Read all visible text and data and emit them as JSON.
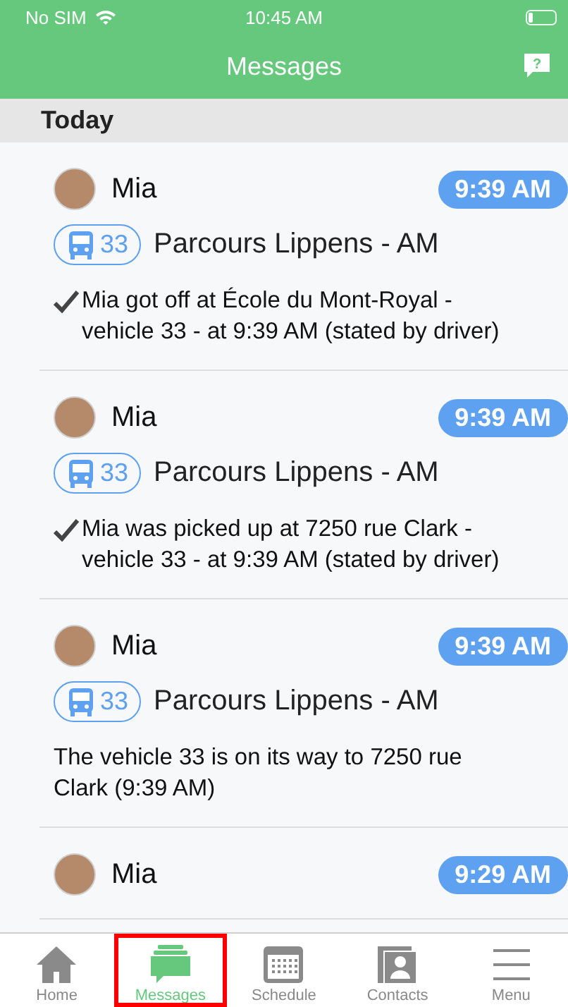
{
  "status_bar": {
    "carrier": "No SIM",
    "time": "10:45 AM"
  },
  "nav_bar": {
    "title": "Messages",
    "help_label": "?"
  },
  "section": {
    "title": "Today"
  },
  "messages": [
    {
      "name": "Mia",
      "time": "9:39 AM",
      "vehicle": "33",
      "route": "Parcours Lippens - AM",
      "confirmed": true,
      "text": "Mia got off at École du Mont-Royal - vehicle 33 - at 9:39 AM (stated by driver)"
    },
    {
      "name": "Mia",
      "time": "9:39 AM",
      "vehicle": "33",
      "route": "Parcours Lippens - AM",
      "confirmed": true,
      "text": "Mia was picked up at 7250 rue Clark - vehicle 33 - at 9:39 AM (stated by driver)"
    },
    {
      "name": "Mia",
      "time": "9:39 AM",
      "vehicle": "33",
      "route": "Parcours Lippens - AM",
      "confirmed": false,
      "text": "The vehicle 33 is on its way to 7250 rue Clark (9:39 AM)"
    },
    {
      "name": "Mia",
      "time": "9:29 AM"
    }
  ],
  "tabs": [
    {
      "label": "Home",
      "kind": "home",
      "selected": false,
      "highlighted": false
    },
    {
      "label": "Messages",
      "kind": "messages",
      "selected": true,
      "highlighted": true
    },
    {
      "label": "Schedule",
      "kind": "schedule",
      "selected": false,
      "highlighted": false
    },
    {
      "label": "Contacts",
      "kind": "contacts",
      "selected": false,
      "highlighted": false
    },
    {
      "label": "Menu",
      "kind": "menu",
      "selected": false,
      "highlighted": false
    }
  ]
}
